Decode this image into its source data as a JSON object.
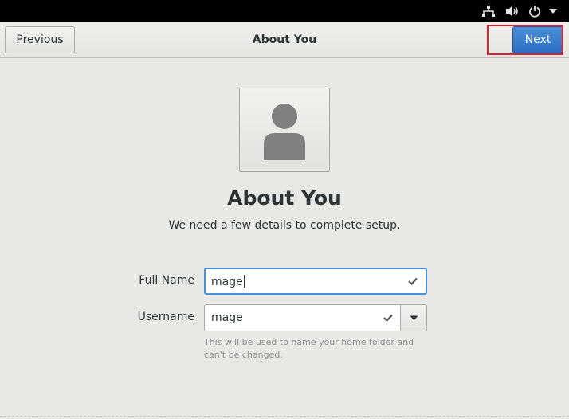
{
  "header": {
    "previous_label": "Previous",
    "title": "About You",
    "next_label": "Next"
  },
  "tray": {
    "icons": [
      "network-icon",
      "volume-icon",
      "power-icon",
      "chevron-down-icon"
    ]
  },
  "main": {
    "title": "About You",
    "subtitle": "We need a few details to complete setup.",
    "full_name": {
      "label": "Full Name",
      "value": "mage"
    },
    "username": {
      "label": "Username",
      "value": "mage"
    },
    "hint": "This will be used to name your home folder and can't be changed."
  },
  "colors": {
    "accent": "#3a80d0",
    "highlight": "#e0202a",
    "top_panel": "#000000"
  }
}
